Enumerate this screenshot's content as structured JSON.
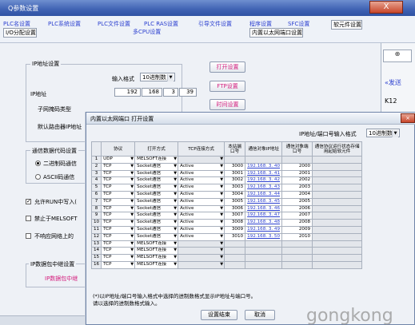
{
  "window": {
    "title": "Q参数设置",
    "close_glyph": "X"
  },
  "tabs": {
    "row1": [
      "PLC名设置",
      "PLC系统设置",
      "PLC文件设置",
      "PLC RAS设置",
      "引导文件设置",
      "程序设置",
      "SFC设置",
      "软元件设置"
    ],
    "row2": [
      "I/O分配设置",
      "多CPU设置",
      "内置以太网端口设置"
    ]
  },
  "right_edge": {
    "combo": "⊕",
    "text1": "«发送",
    "text2": "K12"
  },
  "ip_group": {
    "label": "IP地址设置",
    "input_format_label": "输入格式",
    "input_format_value": "10进制数",
    "ip_label": "IP地址",
    "ip": [
      "192",
      "168",
      "3",
      "39"
    ],
    "subnet_label": "子网掩码类型",
    "gateway_label": "默认路由器IP地址"
  },
  "buttons": {
    "open": "打开设置",
    "ftp": "FTP设置",
    "time": "时间设置"
  },
  "comm_group": {
    "label": "通信数据代码设置",
    "radio_binary": "二进制码通信",
    "radio_ascii": "ASCII码通信"
  },
  "checks": {
    "run_write": "允许RUN中写入(",
    "mcprotocol": "禁止于MELSOFT",
    "no_ping": "不响应网络上的"
  },
  "relay_group": {
    "label": "IP数据包中继设置",
    "item": "IP数据包中继"
  },
  "dialog": {
    "title": "内置以太网端口 打开设置",
    "format_label": "IP地址/端口号输入格式",
    "format_value": "10进制数",
    "headers": [
      "协议",
      "打开方式",
      "TCP连接方式",
      "本站端口号",
      "通信对象IP地址",
      "通信对象端口号",
      "通信协议运行状态存储用起始软元件"
    ],
    "rows": [
      {
        "no": "1",
        "proto": "UDP",
        "open": "MELSOFT连接",
        "tcp": "",
        "port": "",
        "ip": "",
        "rport": ""
      },
      {
        "no": "2",
        "proto": "TCP",
        "open": "Socket通信",
        "tcp": "Active",
        "port": "3000",
        "ip": "192.168. 3. 40",
        "rport": "2000"
      },
      {
        "no": "3",
        "proto": "TCP",
        "open": "Socket通信",
        "tcp": "Active",
        "port": "3001",
        "ip": "192.168. 3. 41",
        "rport": "2001"
      },
      {
        "no": "4",
        "proto": "TCP",
        "open": "Socket通信",
        "tcp": "Active",
        "port": "3002",
        "ip": "192.168. 3. 42",
        "rport": "2002"
      },
      {
        "no": "5",
        "proto": "TCP",
        "open": "Socket通信",
        "tcp": "Active",
        "port": "3003",
        "ip": "192.168. 3. 43",
        "rport": "2003"
      },
      {
        "no": "6",
        "proto": "TCP",
        "open": "Socket通信",
        "tcp": "Active",
        "port": "3004",
        "ip": "192.168. 3. 44",
        "rport": "2004"
      },
      {
        "no": "7",
        "proto": "TCP",
        "open": "Socket通信",
        "tcp": "Active",
        "port": "3005",
        "ip": "192.168. 3. 45",
        "rport": "2005"
      },
      {
        "no": "8",
        "proto": "TCP",
        "open": "Socket通信",
        "tcp": "Active",
        "port": "3006",
        "ip": "192.168. 3. 46",
        "rport": "2006"
      },
      {
        "no": "9",
        "proto": "TCP",
        "open": "Socket通信",
        "tcp": "Active",
        "port": "3007",
        "ip": "192.168. 3. 47",
        "rport": "2007"
      },
      {
        "no": "10",
        "proto": "TCP",
        "open": "Socket通信",
        "tcp": "Active",
        "port": "3008",
        "ip": "192.168. 3. 48",
        "rport": "2008"
      },
      {
        "no": "11",
        "proto": "TCP",
        "open": "Socket通信",
        "tcp": "Active",
        "port": "3009",
        "ip": "192.168. 3. 49",
        "rport": "2009"
      },
      {
        "no": "12",
        "proto": "TCP",
        "open": "Socket通信",
        "tcp": "Active",
        "port": "3010",
        "ip": "192.168. 3. 50",
        "rport": "2010"
      },
      {
        "no": "13",
        "proto": "TCP",
        "open": "MELSOFT连接",
        "tcp": "",
        "port": "",
        "ip": "",
        "rport": ""
      },
      {
        "no": "14",
        "proto": "TCP",
        "open": "MELSOFT连接",
        "tcp": "",
        "port": "",
        "ip": "",
        "rport": ""
      },
      {
        "no": "15",
        "proto": "TCP",
        "open": "MELSOFT连接",
        "tcp": "",
        "port": "",
        "ip": "",
        "rport": ""
      },
      {
        "no": "16",
        "proto": "TCP",
        "open": "MELSOFT连接",
        "tcp": "",
        "port": "",
        "ip": "",
        "rport": ""
      }
    ],
    "note1": "(*)以IP地址/端口号输入格式中选择的进制数格式显示IP地址与端口号。",
    "note2": "请以选择的进制数格式输入。",
    "ok": "设置结束",
    "cancel": "取消"
  },
  "watermark": "gongkong"
}
